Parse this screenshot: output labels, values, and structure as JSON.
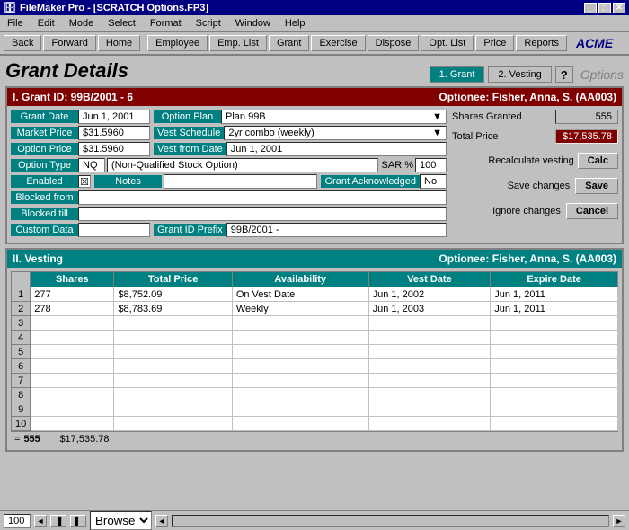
{
  "window": {
    "title": "FileMaker Pro - [SCRATCH Options.FP3]",
    "icon": "🗄"
  },
  "menubar": {
    "items": [
      "File",
      "Edit",
      "Mode",
      "Select",
      "Format",
      "Script",
      "Window",
      "Help"
    ]
  },
  "toolbar": {
    "buttons": [
      "Back",
      "Forward",
      "Home"
    ],
    "nav_buttons": [
      "Employee",
      "Emp. List",
      "Grant",
      "Exercise",
      "Dispose",
      "Opt. List",
      "Price",
      "Reports"
    ],
    "brand": "ACME"
  },
  "page": {
    "title": "Grant Details",
    "tabs": [
      {
        "label": "1. Grant",
        "active": true
      },
      {
        "label": "2. Vesting",
        "active": false
      }
    ],
    "options_label": "Options"
  },
  "section1": {
    "header_id": "I. Grant ID: 99B/2001 - 6",
    "optionee": "Optionee: Fisher, Anna, S. (AA003)",
    "fields": {
      "grant_date_label": "Grant Date",
      "grant_date_value": "Jun 1, 2001",
      "option_plan_label": "Option Plan",
      "option_plan_value": "Plan 99B",
      "market_price_label": "Market Price",
      "market_price_value": "$31.5960",
      "vest_schedule_label": "Vest Schedule",
      "vest_schedule_value": "2yr combo (weekly)",
      "option_price_label": "Option Price",
      "option_price_value": "$31.5960",
      "vest_from_date_label": "Vest from Date",
      "vest_from_date_value": "Jun 1, 2001",
      "option_type_label": "Option Type",
      "option_type_value": "NQ",
      "option_type_desc": "(Non-Qualified Stock Option)",
      "sar_label": "SAR %",
      "sar_value": "100",
      "enabled_label": "Enabled",
      "enabled_checked": true,
      "notes_label": "Notes",
      "notes_value": "",
      "grant_acknowledged_label": "Grant Acknowledged",
      "grant_acknowledged_value": "No",
      "blocked_from_label": "Blocked from",
      "blocked_from_value": "",
      "blocked_till_label": "Blocked till",
      "blocked_till_value": "",
      "custom_data_label": "Custom Data",
      "custom_data_value": "",
      "grant_id_prefix_label": "Grant ID Prefix",
      "grant_id_prefix_value": "99B/2001 -"
    },
    "right_panel": {
      "shares_granted_label": "Shares Granted",
      "shares_granted_value": "555",
      "total_price_label": "Total Price",
      "total_price_value": "$17,535.78",
      "recalculate_label": "Recalculate vesting",
      "calc_btn": "Calc",
      "save_label": "Save changes",
      "save_btn": "Save",
      "ignore_label": "Ignore changes",
      "cancel_btn": "Cancel"
    }
  },
  "section2": {
    "header": "II. Vesting",
    "optionee": "Optionee: Fisher, Anna, S. (AA003)",
    "table": {
      "columns": [
        "Shares",
        "Total Price",
        "Availability",
        "Vest Date",
        "Expire Date"
      ],
      "rows": [
        {
          "num": "1",
          "shares": "277",
          "total_price": "$8,752.09",
          "availability": "On Vest Date",
          "vest_date": "Jun 1, 2002",
          "expire_date": "Jun 1, 2011"
        },
        {
          "num": "2",
          "shares": "278",
          "total_price": "$8,783.69",
          "availability": "Weekly",
          "vest_date": "Jun 1, 2003",
          "expire_date": "Jun 1, 2011"
        },
        {
          "num": "3",
          "shares": "",
          "total_price": "",
          "availability": "",
          "vest_date": "",
          "expire_date": ""
        },
        {
          "num": "4",
          "shares": "",
          "total_price": "",
          "availability": "",
          "vest_date": "",
          "expire_date": ""
        },
        {
          "num": "5",
          "shares": "",
          "total_price": "",
          "availability": "",
          "vest_date": "",
          "expire_date": ""
        },
        {
          "num": "6",
          "shares": "",
          "total_price": "",
          "availability": "",
          "vest_date": "",
          "expire_date": ""
        },
        {
          "num": "7",
          "shares": "",
          "total_price": "",
          "availability": "",
          "vest_date": "",
          "expire_date": ""
        },
        {
          "num": "8",
          "shares": "",
          "total_price": "",
          "availability": "",
          "vest_date": "",
          "expire_date": ""
        },
        {
          "num": "9",
          "shares": "",
          "total_price": "",
          "availability": "",
          "vest_date": "",
          "expire_date": ""
        },
        {
          "num": "10",
          "shares": "",
          "total_price": "",
          "availability": "",
          "vest_date": "",
          "expire_date": ""
        }
      ],
      "footer_eq": "=",
      "footer_shares": "555",
      "footer_total": "$17,535.78"
    }
  },
  "statusbar": {
    "zoom": "100",
    "mode": "Browse"
  }
}
